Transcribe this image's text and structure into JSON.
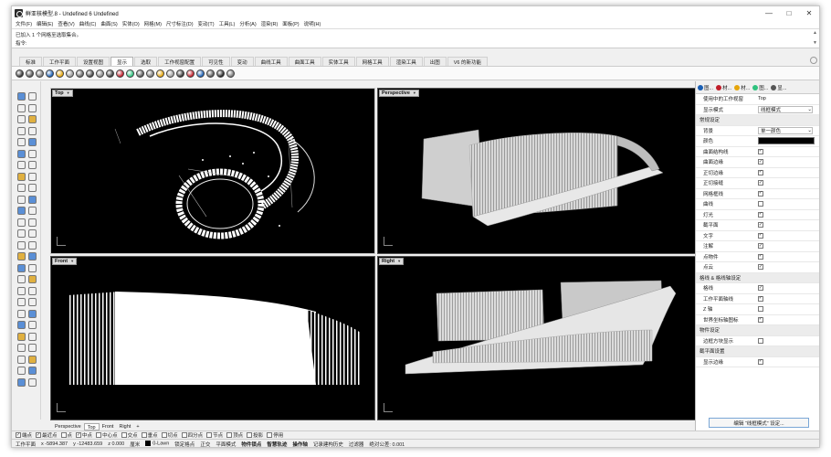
{
  "window": {
    "title": "鲜亚核模型.8 - Undefined 6 Undefined",
    "controls": [
      "—",
      "□",
      "✕"
    ]
  },
  "menu": [
    "文件(F)",
    "编辑(E)",
    "查看(V)",
    "曲线(C)",
    "曲面(S)",
    "实体(O)",
    "网格(M)",
    "尺寸标注(D)",
    "变动(T)",
    "工具(L)",
    "分析(A)",
    "渲染(R)",
    "面板(P)",
    "说明(H)"
  ],
  "command_history": {
    "line1": "已加入 1 个网格至选取集合。",
    "prompt_label": "指令:"
  },
  "tabs": [
    "标准",
    "工作平面",
    "设置视图",
    "显示",
    "选取",
    "工作视窗配置",
    "可见性",
    "变动",
    "曲线工具",
    "曲面工具",
    "实体工具",
    "网格工具",
    "渲染工具",
    "出图",
    "V6 的新功能"
  ],
  "active_tab_index": 3,
  "viewports": {
    "top": "Top",
    "perspective": "Perspective",
    "front": "Front",
    "right": "Right"
  },
  "viewport_tabs": [
    "Perspective",
    "Top",
    "Front",
    "Right",
    "+"
  ],
  "active_viewport_tab": 1,
  "osnap": [
    {
      "label": "端点",
      "checked": true
    },
    {
      "label": "最近点",
      "checked": true
    },
    {
      "label": "点",
      "checked": false
    },
    {
      "label": "中点",
      "checked": true
    },
    {
      "label": "中心点",
      "checked": false
    },
    {
      "label": "交点",
      "checked": false
    },
    {
      "label": "垂点",
      "checked": false
    },
    {
      "label": "切点",
      "checked": false
    },
    {
      "label": "四分点",
      "checked": false
    },
    {
      "label": "节点",
      "checked": false
    },
    {
      "label": "顶点",
      "checked": false
    },
    {
      "label": "投影",
      "checked": false
    },
    {
      "label": "停用",
      "checked": false
    }
  ],
  "status": {
    "cplane": "工作平面",
    "x": "x -5894.387",
    "y": "y -12483.659",
    "z": "z 0.000",
    "unit": "厘米",
    "layer": "0-Lawn",
    "items": [
      "锁定格点",
      "正交",
      "平面模式",
      "物件锁点",
      "智慧轨迹",
      "操作轴",
      "记录建构历史",
      "过滤器",
      "绝对公差: 0.001"
    ],
    "bold_items": [
      3,
      4,
      5
    ]
  },
  "right_panel": {
    "tabs": [
      "图...",
      "材...",
      "材...",
      "图...",
      "显..."
    ],
    "rows": [
      {
        "type": "prop",
        "label": "使用中的工作视窗",
        "value": "Top"
      },
      {
        "type": "prop",
        "label": "显示模式",
        "value": "线框模式",
        "dropdown": true
      },
      {
        "type": "section",
        "label": "常规设定"
      },
      {
        "type": "prop",
        "label": "背景",
        "value": "单一颜色",
        "dropdown": true
      },
      {
        "type": "color",
        "label": "颜色"
      },
      {
        "type": "check",
        "label": "曲面结构线",
        "checked": true
      },
      {
        "type": "check",
        "label": "曲面边缘",
        "checked": true
      },
      {
        "type": "check",
        "label": "正切边缘",
        "checked": true
      },
      {
        "type": "check",
        "label": "正切接缝",
        "checked": true
      },
      {
        "type": "check",
        "label": "网格框线",
        "checked": true
      },
      {
        "type": "check",
        "label": "曲线",
        "checked": false
      },
      {
        "type": "check",
        "label": "灯光",
        "checked": true
      },
      {
        "type": "check",
        "label": "截平面",
        "checked": true
      },
      {
        "type": "check",
        "label": "文字",
        "checked": true
      },
      {
        "type": "check",
        "label": "注解",
        "checked": true
      },
      {
        "type": "check",
        "label": "点物件",
        "checked": true
      },
      {
        "type": "check",
        "label": "点云",
        "checked": true
      },
      {
        "type": "section",
        "label": "格线 & 格线轴设定"
      },
      {
        "type": "check",
        "label": "格线",
        "checked": true
      },
      {
        "type": "check",
        "label": "工作平面轴线",
        "checked": true
      },
      {
        "type": "check",
        "label": "Z 轴",
        "checked": false
      },
      {
        "type": "check",
        "label": "世界坐标轴图标",
        "checked": true
      },
      {
        "type": "section",
        "label": "物件设定"
      },
      {
        "type": "check",
        "label": "边框方块显示",
        "checked": false
      },
      {
        "type": "section",
        "label": "截平面设置"
      },
      {
        "type": "check",
        "label": "显示边缘",
        "checked": true
      }
    ],
    "edit_button": "编辑 “线框模式” 设定..."
  },
  "colors": {
    "viewport_bg": "#000000",
    "geometry": "#ffffff",
    "accent": "#7aa6d6"
  }
}
